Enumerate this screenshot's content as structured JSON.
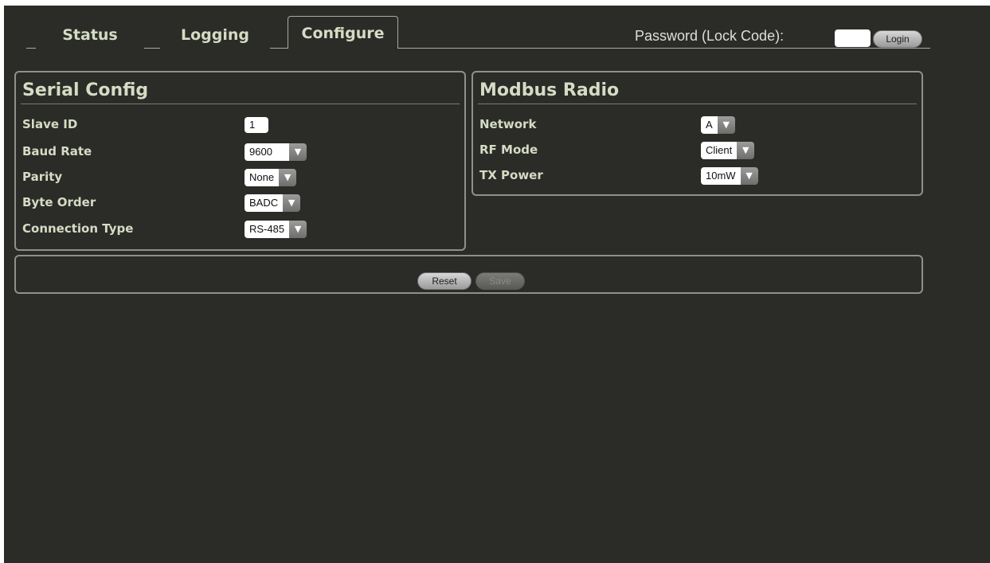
{
  "tabs": [
    {
      "label": "Status"
    },
    {
      "label": "Logging"
    },
    {
      "label": "Configure",
      "active": true
    }
  ],
  "login": {
    "label": "Password (Lock Code):",
    "password_value": "",
    "button_label": "Login"
  },
  "serial_config": {
    "title": "Serial Config",
    "slave_id": {
      "label": "Slave ID",
      "value": "1"
    },
    "baud_rate": {
      "label": "Baud Rate",
      "value": "9600"
    },
    "parity": {
      "label": "Parity",
      "value": "None"
    },
    "byte_order": {
      "label": "Byte Order",
      "value": "BADC"
    },
    "connection_type": {
      "label": "Connection Type",
      "value": "RS-485"
    }
  },
  "modbus_radio": {
    "title": "Modbus Radio",
    "network": {
      "label": "Network",
      "value": "A"
    },
    "rf_mode": {
      "label": "RF Mode",
      "value": "Client"
    },
    "tx_power": {
      "label": "TX Power",
      "value": "10mW"
    }
  },
  "actions": {
    "reset_label": "Reset",
    "save_label": "Save"
  },
  "colors": {
    "background": "#2b2b28",
    "label_green": "#d4dcc4",
    "border": "#8f8f8b"
  },
  "icons": {
    "dropdown": "chevron-down-icon"
  }
}
